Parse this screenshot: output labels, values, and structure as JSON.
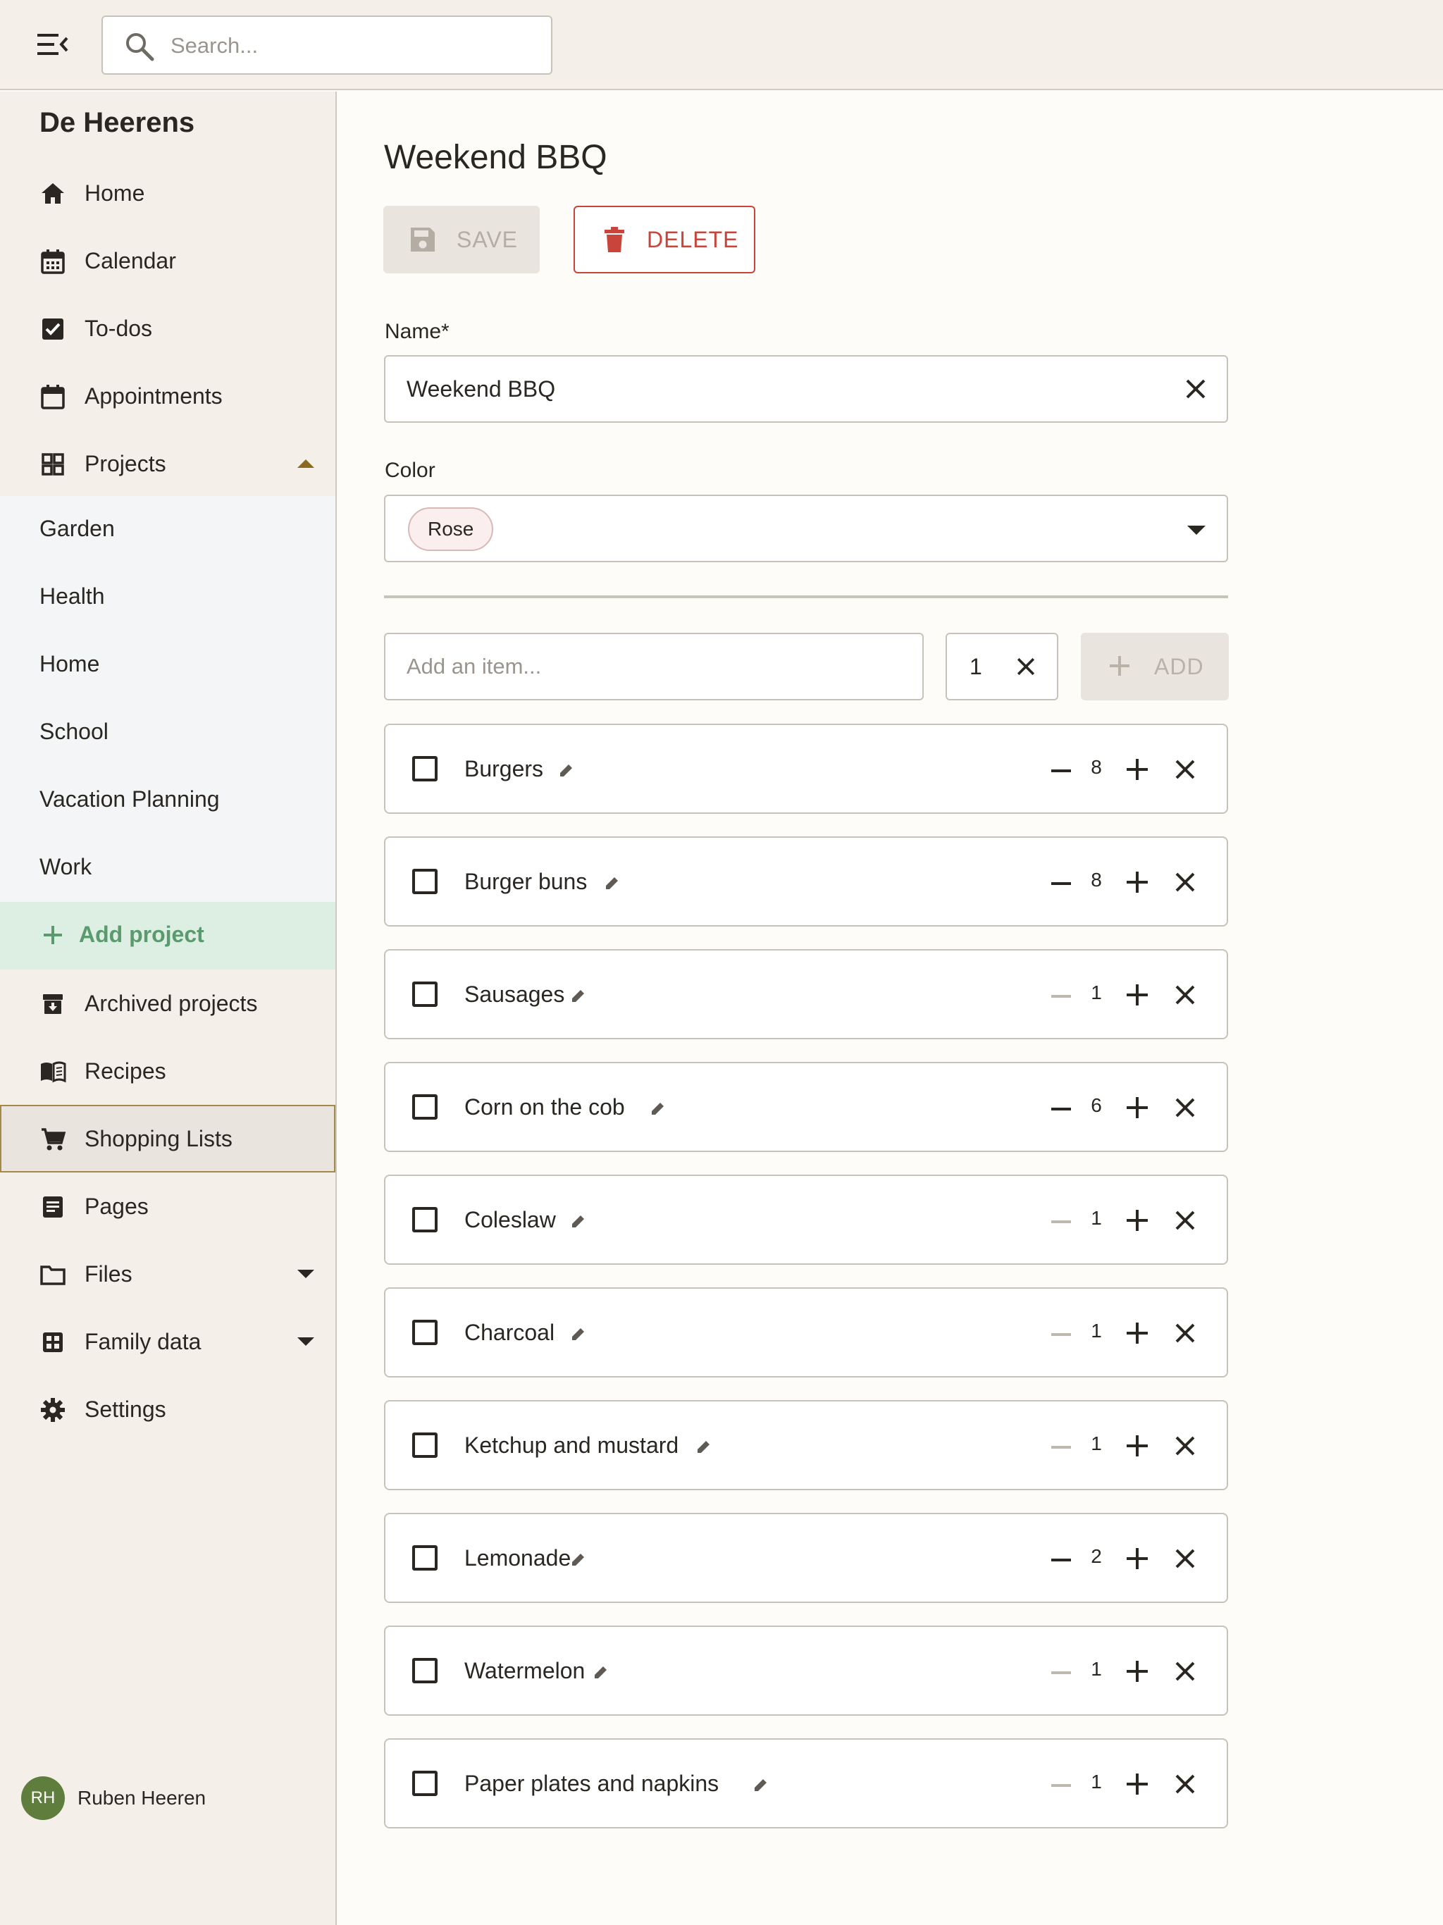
{
  "header": {
    "search_placeholder": "Search..."
  },
  "sidebar": {
    "brand": "De Heerens",
    "nav_top": [
      {
        "label": "Home",
        "icon": "home-icon"
      },
      {
        "label": "Calendar",
        "icon": "calendar-icon"
      },
      {
        "label": "To-dos",
        "icon": "checkbox-icon"
      },
      {
        "label": "Appointments",
        "icon": "calendar-blank-icon"
      },
      {
        "label": "Projects",
        "icon": "grid-icon",
        "expanded": true
      }
    ],
    "projects": [
      "Garden",
      "Health",
      "Home",
      "School",
      "Vacation Planning",
      "Work"
    ],
    "add_project": "Add project",
    "nav_bottom": [
      {
        "label": "Archived projects",
        "icon": "archive-icon"
      },
      {
        "label": "Recipes",
        "icon": "book-icon"
      },
      {
        "label": "Shopping Lists",
        "icon": "cart-icon",
        "active": true
      },
      {
        "label": "Pages",
        "icon": "page-icon"
      },
      {
        "label": "Files",
        "icon": "folder-icon",
        "expandable": true
      },
      {
        "label": "Family data",
        "icon": "table-icon",
        "expandable": true
      },
      {
        "label": "Settings",
        "icon": "gear-icon"
      }
    ],
    "user": {
      "initials": "RH",
      "name": "Ruben Heeren"
    }
  },
  "main": {
    "title": "Weekend BBQ",
    "save_label": "SAVE",
    "delete_label": "DELETE",
    "name_label": "Name*",
    "name_value": "Weekend BBQ",
    "color_label": "Color",
    "color_value": "Rose",
    "add_item_placeholder": "Add an item...",
    "add_qty": "1",
    "add_label": "ADD",
    "items": [
      {
        "name": "Burgers",
        "qty": "8"
      },
      {
        "name": "Burger buns",
        "qty": "8"
      },
      {
        "name": "Sausages",
        "qty": "1"
      },
      {
        "name": "Corn on the cob",
        "qty": "6"
      },
      {
        "name": "Coleslaw",
        "qty": "1"
      },
      {
        "name": "Charcoal",
        "qty": "1"
      },
      {
        "name": "Ketchup and mustard",
        "qty": "1"
      },
      {
        "name": "Lemonade",
        "qty": "2"
      },
      {
        "name": "Watermelon",
        "qty": "1"
      },
      {
        "name": "Paper plates and napkins",
        "qty": "1"
      }
    ]
  },
  "colors": {
    "accent_delete": "#c9443a",
    "active_border": "#a48a4a",
    "add_project_green": "#5a9a6e",
    "avatar": "#5f7d3c"
  }
}
